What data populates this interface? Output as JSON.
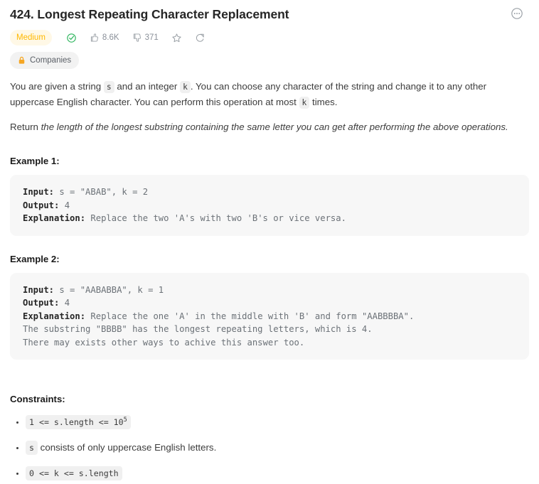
{
  "header": {
    "title": "424. Longest Repeating Character Replacement",
    "more_icon": "circle-ellipsis-icon"
  },
  "meta": {
    "difficulty": "Medium",
    "solved_icon": "check-circle-icon",
    "likes": "8.6K",
    "likes_icon": "thumbs-up-icon",
    "dislikes": "371",
    "dislikes_icon": "thumbs-down-icon",
    "favorite_icon": "star-icon",
    "share_icon": "share-icon"
  },
  "tags": {
    "companies_label": "Companies",
    "companies_icon": "lock-icon"
  },
  "description": {
    "para1_a": "You are given a string ",
    "para1_code1": "s",
    "para1_b": " and an integer ",
    "para1_code2": "k",
    "para1_c": ". You can choose any character of the string and change it to any other uppercase English character. You can perform this operation at most ",
    "para1_code3": "k",
    "para1_d": " times.",
    "para2_lead": "Return ",
    "para2_italic": "the length of the longest substring containing the same letter you can get after performing the above operations."
  },
  "examples": [
    {
      "heading": "Example 1:",
      "input_label": "Input:",
      "input_value": " s = \"ABAB\", k = 2",
      "output_label": "Output:",
      "output_value": " 4",
      "explanation_label": "Explanation:",
      "explanation_value": " Replace the two 'A's with two 'B's or vice versa."
    },
    {
      "heading": "Example 2:",
      "input_label": "Input:",
      "input_value": " s = \"AABABBA\", k = 1",
      "output_label": "Output:",
      "output_value": " 4",
      "explanation_label": "Explanation:",
      "explanation_value": " Replace the one 'A' in the middle with 'B' and form \"AABBBBA\".\nThe substring \"BBBB\" has the longest repeating letters, which is 4.\nThere may exists other ways to achive this answer too."
    }
  ],
  "constraints": {
    "heading": "Constraints:",
    "items": [
      {
        "code_pre": "1 <= s.length <= 10",
        "code_sup": "5",
        "text": ""
      },
      {
        "code_pre": "s",
        "code_sup": "",
        "text": " consists of only uppercase English letters."
      },
      {
        "code_pre": "0 <= k <= s.length",
        "code_sup": "",
        "text": ""
      }
    ]
  },
  "colors": {
    "medium_text": "#ffb800",
    "medium_bg": "#fff8e6",
    "solved_green": "#2db55d",
    "lock_orange": "#f5a623",
    "code_bg": "#f7f7f7",
    "chip_bg": "#f0f0f0",
    "icon_gray": "#9aa0a6"
  }
}
